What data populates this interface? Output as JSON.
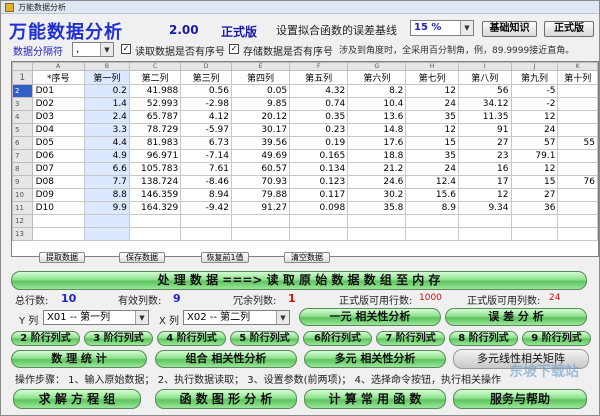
{
  "window_title": "万能数据分析",
  "app": {
    "title": "万能数据分析",
    "version": "2.00",
    "edition": "正式版"
  },
  "baseline": {
    "label": "设置拟合函数的误差基线",
    "value": "15 %"
  },
  "buttons_top": {
    "knowledge": "基础知识",
    "edition": "正式版"
  },
  "sep": {
    "label": "数据分隔符",
    "value": ","
  },
  "chk_seq": {
    "label": "读取数据是否有序号",
    "checked": true
  },
  "chk_store": {
    "label": "存储数据是否有序号",
    "checked": true
  },
  "hint": "涉及到角度时，全采用百分制角，例，89.9999接近直角。",
  "grid": {
    "col_letters": [
      "A",
      "B",
      "C",
      "D",
      "E",
      "F",
      "G",
      "H",
      "I",
      "J",
      "K"
    ],
    "headers": [
      "*序号",
      "第一列",
      "第二列",
      "第三列",
      "第四列",
      "第五列",
      "第六列",
      "第七列",
      "第八列",
      "第九列",
      "第十列"
    ],
    "rows": [
      {
        "n": "2",
        "c": [
          "D01",
          "0.2",
          "41.988",
          "0.56",
          "0.05",
          "4.32",
          "8.2",
          "12",
          "56",
          "-5",
          ""
        ]
      },
      {
        "n": "3",
        "c": [
          "D02",
          "1.4",
          "52.993",
          "-2.98",
          "9.85",
          "0.74",
          "10.4",
          "24",
          "34.12",
          "-2",
          ""
        ]
      },
      {
        "n": "4",
        "c": [
          "D03",
          "2.4",
          "65.787",
          "4.12",
          "20.12",
          "0.35",
          "13.6",
          "35",
          "11.35",
          "12",
          ""
        ]
      },
      {
        "n": "5",
        "c": [
          "D04",
          "3.3",
          "78.729",
          "-5.97",
          "30.17",
          "0.23",
          "14.8",
          "12",
          "91",
          "24",
          ""
        ]
      },
      {
        "n": "6",
        "c": [
          "D05",
          "4.4",
          "81.983",
          "6.73",
          "39.56",
          "0.19",
          "17.6",
          "15",
          "27",
          "57",
          "55"
        ]
      },
      {
        "n": "7",
        "c": [
          "D06",
          "4.9",
          "96.971",
          "-7.14",
          "49.69",
          "0.165",
          "18.8",
          "35",
          "23",
          "79.1",
          ""
        ]
      },
      {
        "n": "8",
        "c": [
          "D07",
          "6.6",
          "105.783",
          "7.61",
          "60.57",
          "0.134",
          "21.2",
          "24",
          "16",
          "12",
          ""
        ]
      },
      {
        "n": "9",
        "c": [
          "D08",
          "7.7",
          "138.724",
          "-8.46",
          "70.93",
          "0.123",
          "24.6",
          "12.4",
          "17",
          "15",
          "76"
        ]
      },
      {
        "n": "10",
        "c": [
          "D09",
          "8.8",
          "146.359",
          "8.94",
          "79.88",
          "0.117",
          "30.2",
          "15.6",
          "12",
          "27",
          ""
        ]
      },
      {
        "n": "11",
        "c": [
          "D10",
          "9.9",
          "164.329",
          "-9.42",
          "91.27",
          "0.098",
          "35.8",
          "8.9",
          "9.34",
          "36",
          ""
        ]
      },
      {
        "n": "12",
        "c": [
          "",
          "",
          "",
          "",
          "",
          "",
          "",
          "",
          "",
          "",
          ""
        ]
      },
      {
        "n": "13",
        "c": [
          "",
          "",
          "",
          "",
          "",
          "",
          "",
          "",
          "",
          "",
          ""
        ]
      }
    ]
  },
  "small_btns": [
    "提取数据",
    "保存数据",
    "恢复前1值",
    "清空数据"
  ],
  "process_btn": "处 理 数 据 ===> 读 取 原 始 数 据 数 组 至 内 存",
  "stats": {
    "total_rows_label": "总行数:",
    "total_rows": "10",
    "valid_cols_label": "有效列数:",
    "valid_cols": "9",
    "redundant_label": "冗余列数:",
    "redundant": "1",
    "rows_avail_label": "正式版可用行数:",
    "rows_avail": "1000",
    "cols_avail_label": "正式版可用列数:",
    "cols_avail": "24"
  },
  "yx": {
    "y_label": "Y 列",
    "y_value": "X01 -- 第一列",
    "x_label": "X 列",
    "x_value": "X02 -- 第二列"
  },
  "btn_linear": "一元 相关性分析",
  "btn_error": "误 差 分 析",
  "poly_btns": [
    "2 阶行列式",
    "3 阶行列式",
    "4 阶行列式",
    "5 阶行列式",
    "6阶行列式",
    "7 阶行列式",
    "8 阶行列式",
    "9 阶行列式"
  ],
  "btn_stats": "数 理 统 计",
  "btn_combo": "组合 相关性分析",
  "btn_multi": "多元 相关性分析",
  "btn_matrix": "多元线性相关矩阵",
  "steps": "操作步骤：  1、输入原始数据；  2、执行数据读取；  3、设置参数(前两项)；  4、选择命令按钮，执行相关操作",
  "bottom_btns": [
    "求 解 方 程 组",
    "函 数 图 形 分 析",
    "计 算 常 用 函 数",
    "服务与帮助"
  ],
  "watermark": "东坡下载站",
  "colors": {
    "green": "#6ed06e",
    "title_blue": "#1f2fd0",
    "red": "#cc1111",
    "selected_col": "#dbe8ff"
  }
}
